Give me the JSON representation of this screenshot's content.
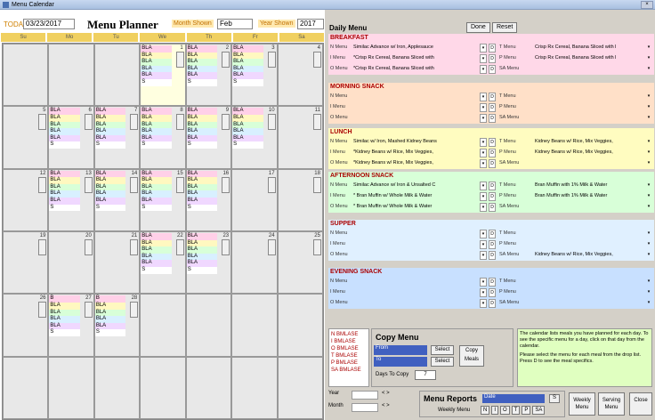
{
  "window": {
    "title": "Menu Calendar",
    "close": "×"
  },
  "header": {
    "today_label": "TODAY",
    "today_value": "03/23/2017",
    "title": "Menu Planner",
    "month_label": "Month Shown",
    "month_value": "Feb",
    "year_label": "Year Shown",
    "year_value": "2017"
  },
  "days": [
    "Su",
    "Mo",
    "Tu",
    "We",
    "Th",
    "Fr",
    "Sa"
  ],
  "calendar": [
    {
      "num": "",
      "lines": []
    },
    {
      "num": "",
      "lines": []
    },
    {
      "num": "",
      "lines": []
    },
    {
      "num": "1",
      "lines": [
        "BLA",
        "BLA",
        "BLA",
        "BLA",
        "BLA",
        "S"
      ]
    },
    {
      "num": "2",
      "lines": [
        "BLA",
        "BLA",
        "BLA",
        "BLA",
        "BLA",
        "S"
      ]
    },
    {
      "num": "3",
      "lines": [
        "BLA",
        "BLA",
        "BLA",
        "BLA",
        "BLA",
        "S"
      ]
    },
    {
      "num": "4",
      "lines": []
    },
    {
      "num": "5",
      "lines": []
    },
    {
      "num": "6",
      "lines": [
        "BLA",
        "BLA",
        "BLA",
        "BLA",
        "BLA",
        "S"
      ]
    },
    {
      "num": "7",
      "lines": [
        "BLA",
        "BLA",
        "BLA",
        "BLA",
        "BLA",
        "S"
      ]
    },
    {
      "num": "8",
      "lines": [
        "BLA",
        "BLA",
        "BLA",
        "BLA",
        "BLA",
        "S"
      ]
    },
    {
      "num": "9",
      "lines": [
        "BLA",
        "BLA",
        "BLA",
        "BLA",
        "BLA",
        "S"
      ]
    },
    {
      "num": "10",
      "lines": [
        "BLA",
        "BLA",
        "BLA",
        "BLA",
        "BLA",
        "S"
      ]
    },
    {
      "num": "11",
      "lines": []
    },
    {
      "num": "12",
      "lines": []
    },
    {
      "num": "13",
      "lines": [
        "BLA",
        "BLA",
        "BLA",
        "BLA",
        "BLA",
        "S"
      ]
    },
    {
      "num": "14",
      "lines": [
        "BLA",
        "BLA",
        "BLA",
        "BLA",
        "BLA",
        "S"
      ]
    },
    {
      "num": "15",
      "lines": [
        "BLA",
        "BLA",
        "BLA",
        "BLA",
        "BLA",
        "S"
      ]
    },
    {
      "num": "16",
      "lines": [
        "BLA",
        "BLA",
        "BLA",
        "BLA",
        "BLA",
        "S"
      ]
    },
    {
      "num": "17",
      "lines": []
    },
    {
      "num": "18",
      "lines": []
    },
    {
      "num": "19",
      "lines": []
    },
    {
      "num": "20",
      "lines": []
    },
    {
      "num": "21",
      "lines": []
    },
    {
      "num": "22",
      "lines": [
        "BLA",
        "BLA",
        "BLA",
        "BLA",
        "BLA",
        "S"
      ]
    },
    {
      "num": "23",
      "lines": [
        "BLA",
        "BLA",
        "BLA",
        "BLA",
        "BLA",
        "S"
      ]
    },
    {
      "num": "24",
      "lines": []
    },
    {
      "num": "25",
      "lines": []
    },
    {
      "num": "26",
      "lines": []
    },
    {
      "num": "27",
      "lines": [
        "B",
        "BLA",
        "BLA",
        "BLA",
        "BLA",
        "S"
      ]
    },
    {
      "num": "28",
      "lines": [
        "B",
        "BLA",
        "BLA",
        "BLA",
        "BLA",
        "S"
      ]
    },
    {
      "num": "",
      "lines": []
    },
    {
      "num": "",
      "lines": []
    },
    {
      "num": "",
      "lines": []
    },
    {
      "num": "",
      "lines": []
    },
    {
      "num": "",
      "lines": []
    },
    {
      "num": "",
      "lines": []
    },
    {
      "num": "",
      "lines": []
    },
    {
      "num": "",
      "lines": []
    },
    {
      "num": "",
      "lines": []
    },
    {
      "num": "",
      "lines": []
    },
    {
      "num": "",
      "lines": []
    }
  ],
  "daily": {
    "title": "Daily Menu",
    "done": "Done",
    "reset": "Reset",
    "d": "D",
    "dd": "▾",
    "sections": [
      {
        "name": "BREAKFAST",
        "rows": [
          [
            "N Menu",
            "Similac Advance w/ Iron, Applesauce",
            "T Menu",
            "Crisp Rx Cereal, Banana Sliced with l"
          ],
          [
            "I Menu",
            "*Crisp Rx Cereal, Banana Sliced with",
            "P Menu",
            "Crisp Rx Cereal, Banana Sliced with l"
          ],
          [
            "O Menu",
            "*Crisp Rx Cereal, Banana Sliced with",
            "SA Menu",
            ""
          ]
        ]
      },
      {
        "name": "MORNING SNACK",
        "rows": [
          [
            "N Menu",
            "",
            "T Menu",
            ""
          ],
          [
            "I Menu",
            "",
            "P Menu",
            ""
          ],
          [
            "O Menu",
            "",
            "SA Menu",
            ""
          ]
        ]
      },
      {
        "name": "LUNCH",
        "rows": [
          [
            "N Menu",
            "Similac w/ Iron, Mashed Kidney Beans",
            "T Menu",
            "Kidney Beans w/ Rice, Mix Veggies,"
          ],
          [
            "I Menu",
            "*Kidney Beans w/ Rice, Mix Veggies,",
            "P Menu",
            "Kidney Beans w/ Rice, Mix Veggies,"
          ],
          [
            "O Menu",
            "*Kidney Beans w/ Rice, Mix Veggies,",
            "SA Menu",
            ""
          ]
        ]
      },
      {
        "name": "AFTERNOON SNACK",
        "rows": [
          [
            "N Menu",
            "Similac Advance w/ Iron & Unsalted C",
            "T Menu",
            "Bran Muffin with 1% Milk & Water"
          ],
          [
            "I Menu",
            "* Bran Muffin w/ Whole Milk & Water",
            "P Menu",
            "Bran Muffin with 1% Milk & Water"
          ],
          [
            "O Menu",
            "* Bran Muffin w/ Whole Milk & Water",
            "SA Menu",
            ""
          ]
        ]
      },
      {
        "name": "SUPPER",
        "rows": [
          [
            "N Menu",
            "",
            "T Menu",
            ""
          ],
          [
            "I Menu",
            "",
            "P Menu",
            ""
          ],
          [
            "O Menu",
            "",
            "SA Menu",
            "Kidney Beans w/ Rice, Mix Veggies,"
          ]
        ]
      },
      {
        "name": "EVENING SNACK",
        "rows": [
          [
            "N Menu",
            "",
            "T Menu",
            ""
          ],
          [
            "I Menu",
            "",
            "P Menu",
            ""
          ],
          [
            "O Menu",
            "",
            "SA Menu",
            ""
          ]
        ]
      }
    ]
  },
  "legend": [
    "N  BMLASE",
    "I   BMLASE",
    "O  BMLASE",
    "T  BMLASE",
    "P  BMLASE",
    "SA BMLASE"
  ],
  "copy": {
    "title": "Copy Menu",
    "from": "From",
    "to": "To",
    "select": "Select",
    "copy": "Copy Meals",
    "days": "Days To Copy",
    "days_val": "7"
  },
  "info": {
    "p1": "The calendar lists meals you have planned for each day. To see the specific menu for a day, click on that day from the calendar.",
    "p2": "Please select the menu for each meal from the drop list. Press D to see the meal specifics."
  },
  "nav": {
    "year": "Year",
    "month": "Month"
  },
  "reports": {
    "title": "Menu Reports",
    "date": "Date",
    "weekly": "Weekly Menu",
    "letters": [
      "N",
      "I",
      "O",
      "T",
      "P",
      "SA"
    ],
    "s": "S"
  },
  "buttons": {
    "weekly": "Weekly Menu",
    "serving": "Serving Menu",
    "close": "Close"
  }
}
